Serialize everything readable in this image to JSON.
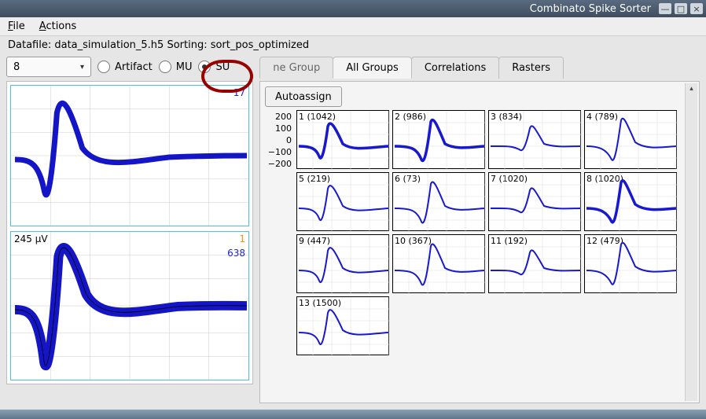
{
  "window": {
    "title": "Combinato Spike Sorter"
  },
  "menu": {
    "file": "File",
    "actions": "Actions",
    "file_u": "F",
    "actions_u": "A"
  },
  "status_text": "Datafile: data_simulation_5.h5 Sorting: sort_pos_optimized",
  "toolbar": {
    "combo_value": "8",
    "radio_artifact": "Artifact",
    "radio_mu": "MU",
    "radio_su": "SU",
    "radio_selected": "SU"
  },
  "tabs": {
    "one_group": "ne Group",
    "all_groups": "All Groups",
    "correlations": "Correlations",
    "rasters": "Rasters",
    "active": "all_groups"
  },
  "left": {
    "top_count": "17",
    "bot_uv": "245 µV",
    "bot_orange": "1",
    "bot_count": "638"
  },
  "right": {
    "autoassign": "Autoassign",
    "y_ticks": [
      "200",
      "100",
      "0",
      "−100",
      "−200"
    ],
    "clusters": [
      {
        "id": 1,
        "label": "1 (1042)"
      },
      {
        "id": 2,
        "label": "2 (986)"
      },
      {
        "id": 3,
        "label": "3 (834)"
      },
      {
        "id": 4,
        "label": "4 (789)"
      },
      {
        "id": 5,
        "label": "5 (219)"
      },
      {
        "id": 6,
        "label": "6 (73)"
      },
      {
        "id": 7,
        "label": "7 (1020)"
      },
      {
        "id": 8,
        "label": "8 (1020)"
      },
      {
        "id": 9,
        "label": "9 (447)"
      },
      {
        "id": 10,
        "label": "10 (367)"
      },
      {
        "id": 11,
        "label": "11 (192)"
      },
      {
        "id": 12,
        "label": "12 (479)"
      },
      {
        "id": 13,
        "label": "13 (1500)"
      }
    ]
  }
}
